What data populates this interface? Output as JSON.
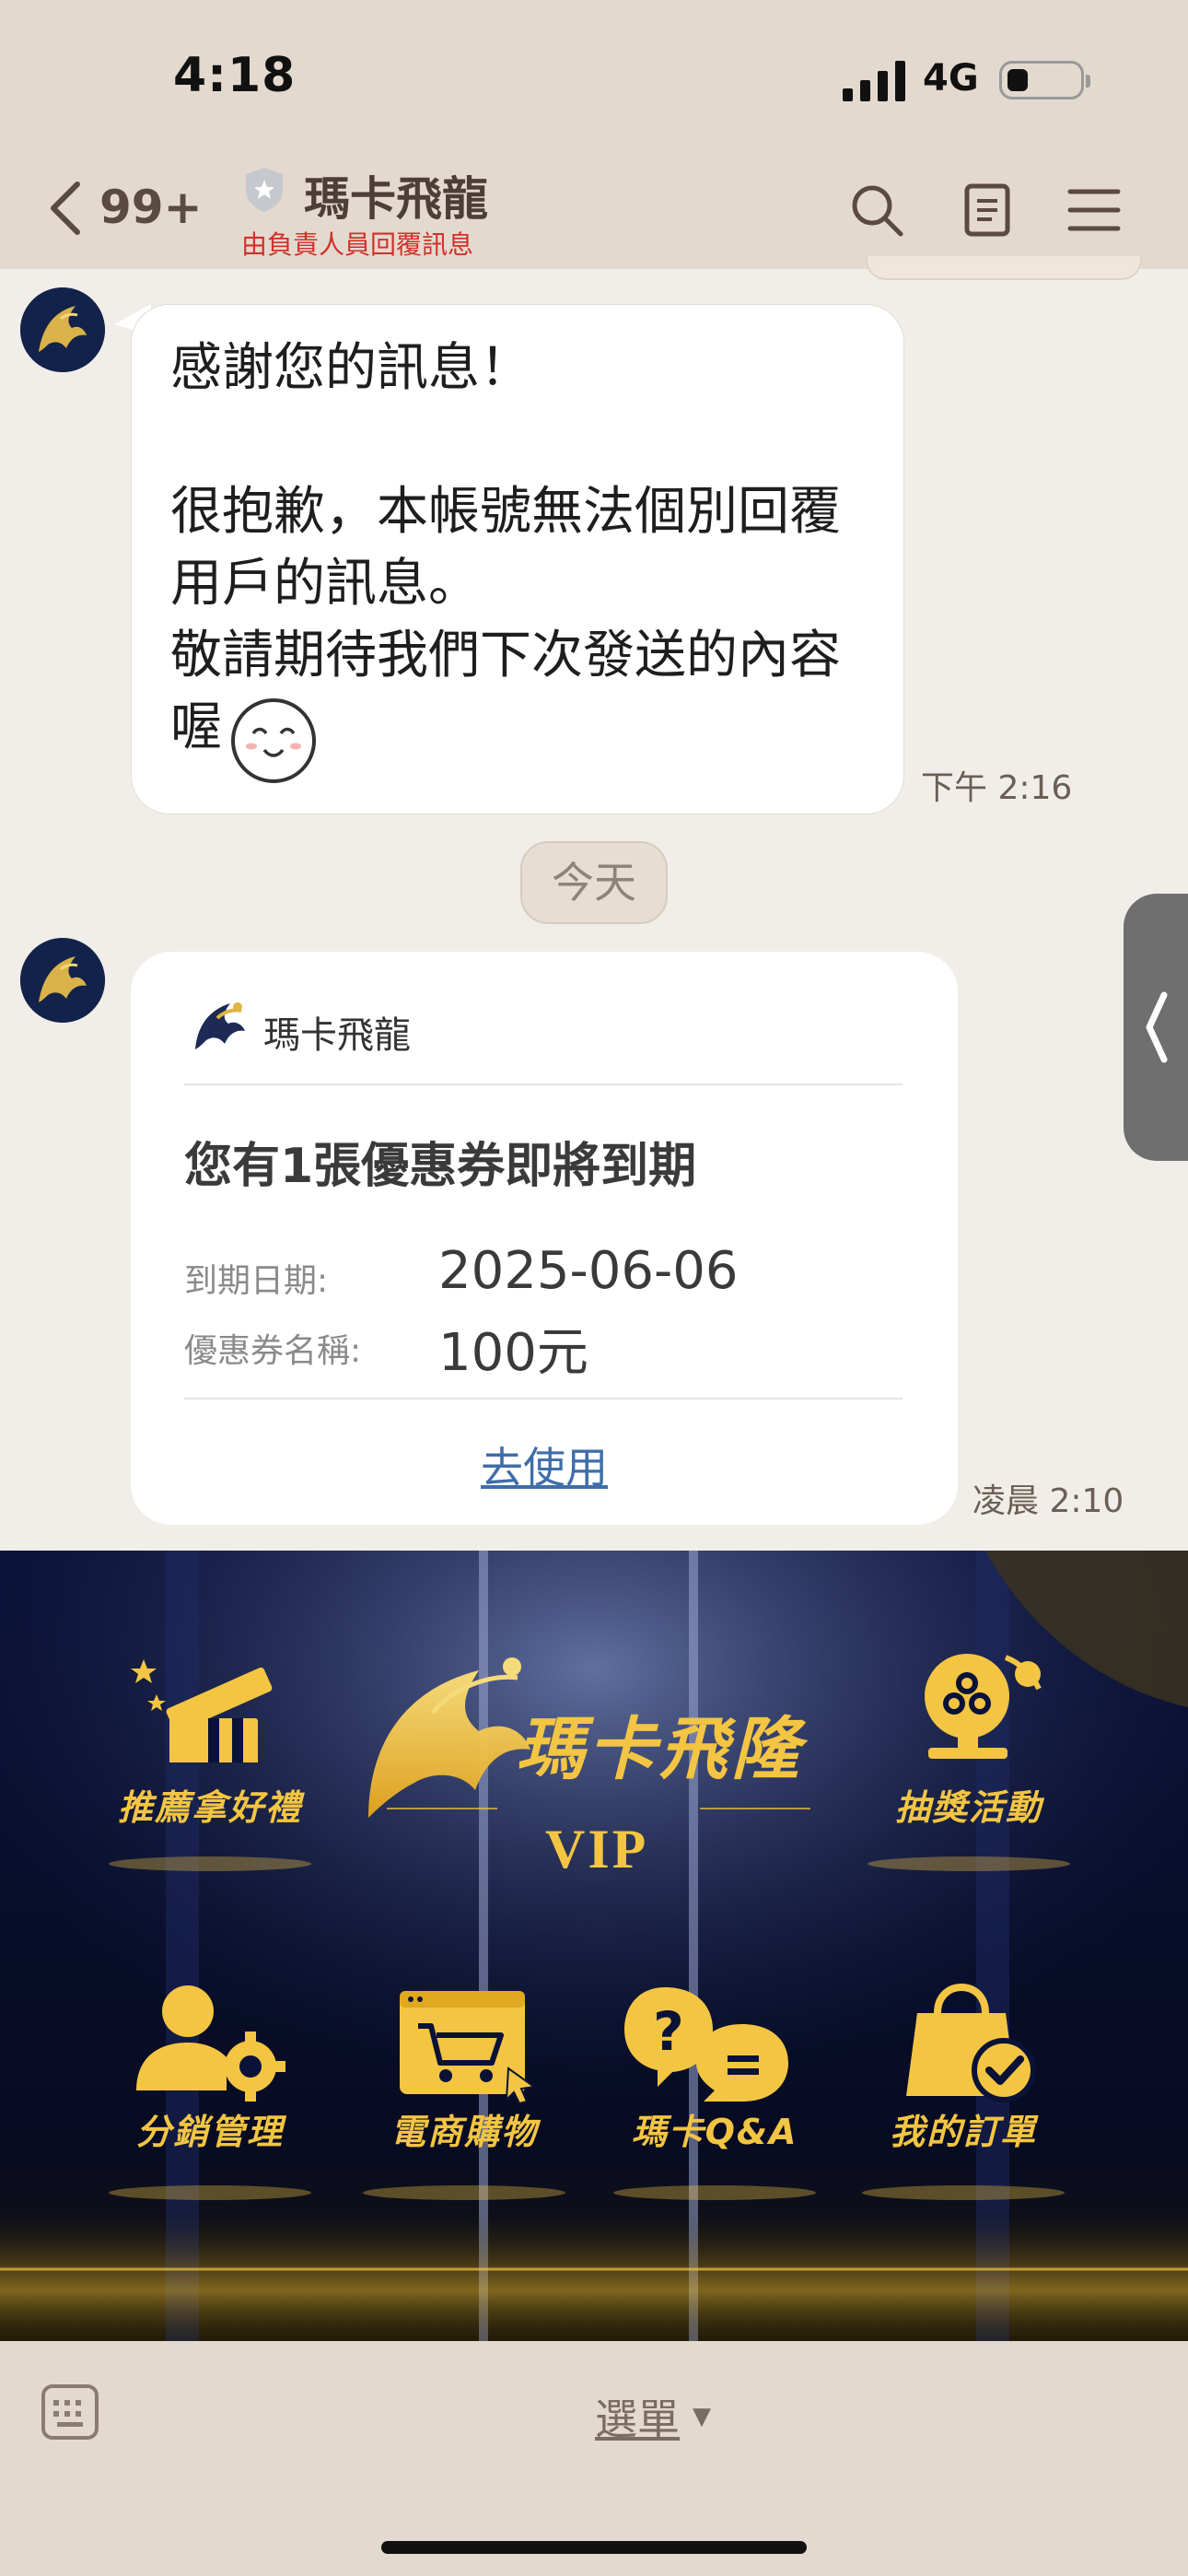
{
  "status": {
    "time": "4:18",
    "network": "4G"
  },
  "header": {
    "unread_count": "99+",
    "title": "瑪卡飛龍",
    "subtitle": "由負責人員回覆訊息"
  },
  "messages": [
    {
      "text": "感謝您的訊息！\n\n很抱歉，本帳號無法個別回覆用戶的訊息。\n敬請期待我們下次發送的內容喔",
      "time": "下午 2:16"
    }
  ],
  "date_divider": "今天",
  "coupon_card": {
    "brand": "瑪卡飛龍",
    "headline": "您有1張優惠券即將到期",
    "expiry_label": "到期日期:",
    "expiry_value": "2025-06-06",
    "name_label": "優惠券名稱:",
    "name_value": "100元",
    "action": "去使用",
    "time": "凌晨 2:10"
  },
  "rich_menu": {
    "logo_text": "瑪卡飛隆",
    "vip": "VIP",
    "items": [
      {
        "label": "推薦拿好禮",
        "icon": "gift-icon"
      },
      {
        "label": "抽獎活動",
        "icon": "lottery-icon"
      },
      {
        "label": "分銷管理",
        "icon": "user-gear-icon"
      },
      {
        "label": "電商購物",
        "icon": "shopping-cart-icon"
      },
      {
        "label": "瑪卡Q&A",
        "icon": "question-chat-icon"
      },
      {
        "label": "我的訂單",
        "icon": "shopping-bag-check-icon"
      }
    ]
  },
  "bottom_bar": {
    "menu_label": "選單"
  },
  "colors": {
    "header_bg": "#e4d9ce",
    "chat_bg": "#f1eee9",
    "accent_gold": "#f3c542",
    "link": "#3f6ea8",
    "alert_red": "#d0302b"
  }
}
